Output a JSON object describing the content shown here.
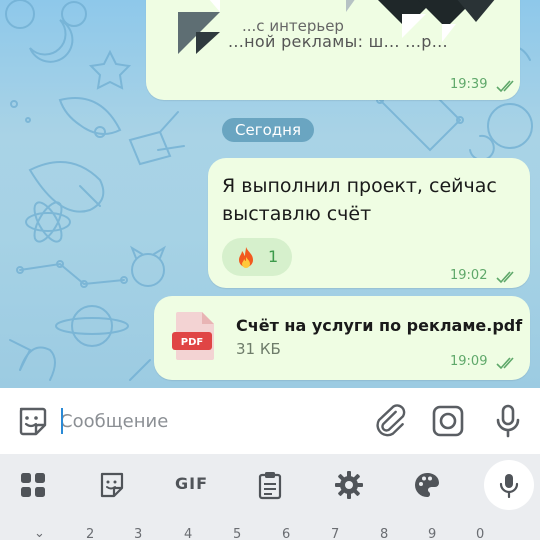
{
  "chat": {
    "top_message": {
      "preview_line1": "...с интерьер",
      "preview_line2": "...ной рекламы: ш... ...р...",
      "time": "19:39"
    },
    "date_separator": "Сегодня",
    "text_message": {
      "text": "Я выполнил проект, сейчас выставлю счёт",
      "reaction_emoji": "fire-icon",
      "reaction_count": "1",
      "time": "19:02"
    },
    "file_message": {
      "file_type": "PDF",
      "file_name": "Счёт на услуги по рекламе.pdf",
      "file_size": "31 КБ",
      "time": "19:09"
    }
  },
  "input": {
    "placeholder": "Сообщение"
  },
  "keyboard": {
    "gif_label": "GIF",
    "numbers": [
      "2",
      "3",
      "4",
      "5",
      "6",
      "7",
      "8",
      "9",
      "0"
    ],
    "collapse_glyph": "⌄"
  },
  "colors": {
    "bubble": "#effde3",
    "accent_green": "#5fa86a",
    "date_pill": "#5696b4",
    "pdf_red": "#e04545"
  }
}
